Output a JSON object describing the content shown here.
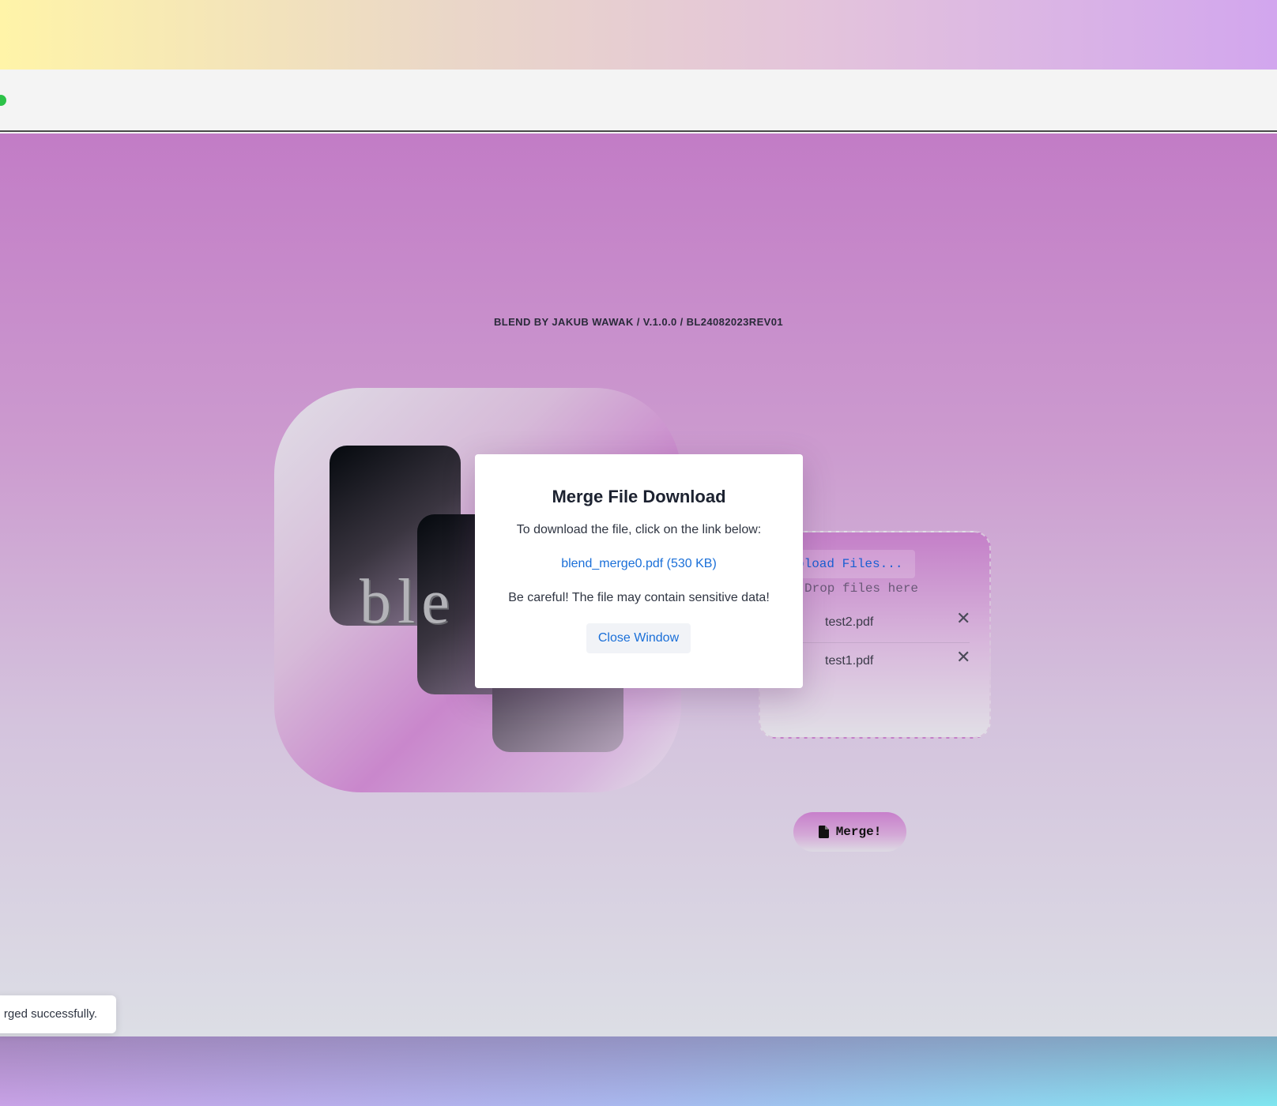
{
  "app": {
    "version_line": "BLEND BY JAKUB WAWAK / V.1.0.0 / BL24082023REV01",
    "logo_text": "ble"
  },
  "upload": {
    "upload_label": "pload Files...",
    "drop_text": "Drop files here",
    "files": [
      {
        "name": "test2.pdf",
        "remove_label": "✕"
      },
      {
        "name": "test1.pdf",
        "remove_label": "✕"
      }
    ]
  },
  "merge_button": {
    "label": "Merge!",
    "icon": "document-icon"
  },
  "modal": {
    "title": "Merge File Download",
    "instruction": "To download the file, click on the link below:",
    "link_text": "blend_merge0.pdf (530 KB)",
    "warning": "Be careful! The file may contain sensitive data!",
    "close_label": "Close Window"
  },
  "toast": {
    "text": "rged successfully."
  },
  "colors": {
    "link": "#1a6fd8",
    "traffic_green": "#2dc248",
    "content_top": "#c27cc6",
    "content_bottom": "#dcdee5"
  }
}
